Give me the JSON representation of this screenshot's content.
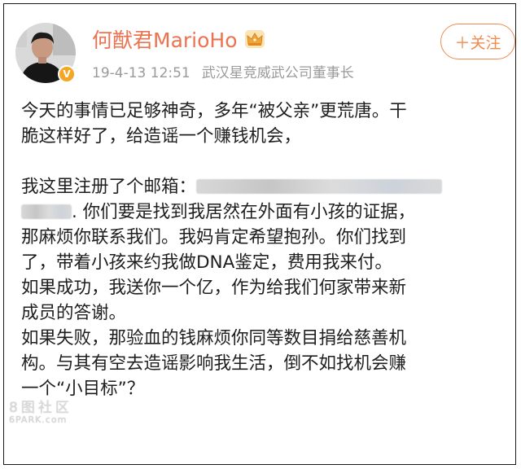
{
  "user": {
    "name": "何猷君MarioHo",
    "vip_badge": "V",
    "timestamp": "19-4-13 12:51",
    "title": "武汉星竞威武公司董事长"
  },
  "follow_button": {
    "label": "＋关注"
  },
  "post": {
    "line1": "今天的事情已足够神奇，多年“被父亲”更荒唐。干",
    "line2": "脆这样好了，给造谣一个赚钱机会，",
    "line3_prefix": "我这里注册了个邮箱：",
    "line4_suffix": ". 你们要是找到我居然在外面有小孩的证据，",
    "line5": "那麻烦你联系我们。我妈肯定希望抱孙。你们找到",
    "line6": "了，带着小孩来约我做DNA鉴定，费用我来付。",
    "line7": "如果成功，我送你一个亿，作为给我们何家带来新",
    "line8": "成员的答谢。",
    "line9": "如果失败，那验血的钱麻烦你同等数目捐给慈善机",
    "line10": "构。与其有空去造谣影响我生活，倒不如找机会赚",
    "line11": "一个“小目标”？"
  },
  "watermark": {
    "cn": "8图社区",
    "en": "6PARK.com"
  },
  "colors": {
    "username": "#eb7350",
    "follow": "#ef8b4d",
    "meta": "#9a9a9a",
    "text": "#1e1e1e"
  }
}
